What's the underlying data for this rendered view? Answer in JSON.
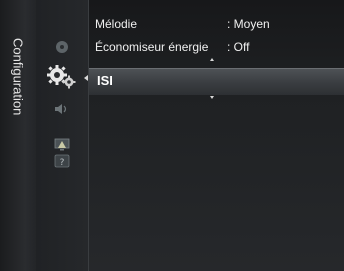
{
  "sidebar": {
    "title": "Configuration",
    "icons": [
      "disc-icon",
      "gear-settings-icon",
      "sound-icon",
      "picture-icon",
      "help-icon"
    ]
  },
  "menu": {
    "rows": [
      {
        "label": "Mélodie",
        "value": ": Moyen"
      },
      {
        "label": "Économiseur énergie",
        "value": ": Off"
      }
    ],
    "selected": {
      "label": "ISI"
    }
  }
}
